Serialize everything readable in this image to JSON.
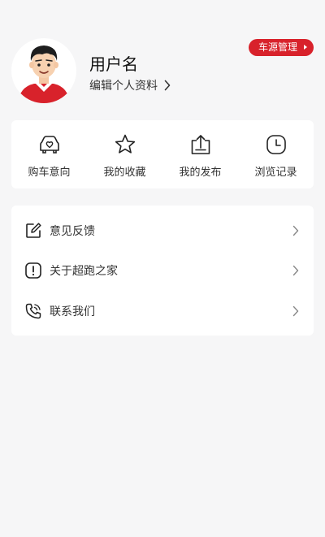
{
  "profile": {
    "username": "用户名",
    "edit_label": "编辑个人资料",
    "car_source_button": "车源管理"
  },
  "quick_actions": [
    {
      "label": "购车意向",
      "icon": "car-heart-icon"
    },
    {
      "label": "我的收藏",
      "icon": "star-icon"
    },
    {
      "label": "我的发布",
      "icon": "upload-icon"
    },
    {
      "label": "浏览记录",
      "icon": "clock-icon"
    }
  ],
  "menu": [
    {
      "label": "意见反馈",
      "icon": "edit-icon"
    },
    {
      "label": "关于超跑之家",
      "icon": "info-icon"
    },
    {
      "label": "联系我们",
      "icon": "phone-icon"
    }
  ],
  "colors": {
    "accent": "#d8222b",
    "background": "#f6f6f7",
    "card": "#ffffff"
  }
}
